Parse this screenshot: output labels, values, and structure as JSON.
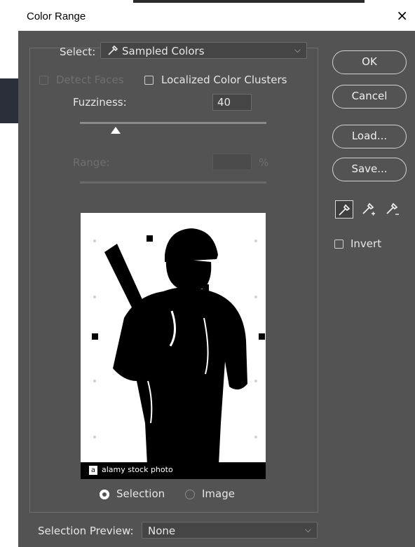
{
  "window": {
    "title": "Color Range",
    "close_glyph": "×"
  },
  "select": {
    "label": "Select:",
    "value": "Sampled Colors"
  },
  "detect_faces": {
    "label": "Detect Faces",
    "checked": false,
    "enabled": false
  },
  "localized_clusters": {
    "label": "Localized Color Clusters",
    "checked": false
  },
  "fuzziness": {
    "label": "Fuzziness:",
    "value": "40",
    "slider_fraction": 0.2
  },
  "range": {
    "label": "Range:",
    "unit": "%",
    "value": ""
  },
  "buttons": {
    "ok": "OK",
    "cancel": "Cancel",
    "load": "Load...",
    "save": "Save..."
  },
  "eyedroppers": [
    {
      "name": "eyedropper-icon",
      "selected": true
    },
    {
      "name": "eyedropper-plus-icon",
      "selected": false
    },
    {
      "name": "eyedropper-minus-icon",
      "selected": false
    }
  ],
  "invert": {
    "label": "Invert",
    "checked": false
  },
  "preview": {
    "watermark": "alamy stock photo",
    "logo_letter": "a"
  },
  "view_mode": {
    "selection_label": "Selection",
    "image_label": "Image",
    "selected": "Selection"
  },
  "selection_preview": {
    "label": "Selection Preview:",
    "value": "None"
  },
  "colors": {
    "dialog_bg": "#535353",
    "field_bg": "#454545",
    "title_bg": "#ffffff"
  }
}
